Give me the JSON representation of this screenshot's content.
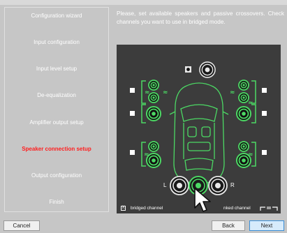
{
  "sidebar": {
    "items": [
      {
        "label": "Configuration wizard",
        "active": false
      },
      {
        "label": "Input configuration",
        "active": false
      },
      {
        "label": "Input level setup",
        "active": false
      },
      {
        "label": "De-equalization",
        "active": false
      },
      {
        "label": "Amplifier output setup",
        "active": false
      },
      {
        "label": "Speaker connection setup",
        "active": true
      },
      {
        "label": "Output configuration",
        "active": false
      },
      {
        "label": "Finish",
        "active": false
      }
    ]
  },
  "main": {
    "instructions": "Please, set available speakers and passive crossovers. Check channels you want to use in bridged mode."
  },
  "diagram": {
    "sub_left_label": "L",
    "sub_right_label": "R",
    "legend": {
      "bridged_box": "X",
      "bridged_label": "bridged channel",
      "linked_label": "nked channel"
    },
    "colors": {
      "active_speaker": "#4cd964",
      "panel_bg": "#3c3c3c"
    }
  },
  "footer": {
    "cancel_label": "Cancel",
    "back_label": "Back",
    "next_label": "Next"
  }
}
